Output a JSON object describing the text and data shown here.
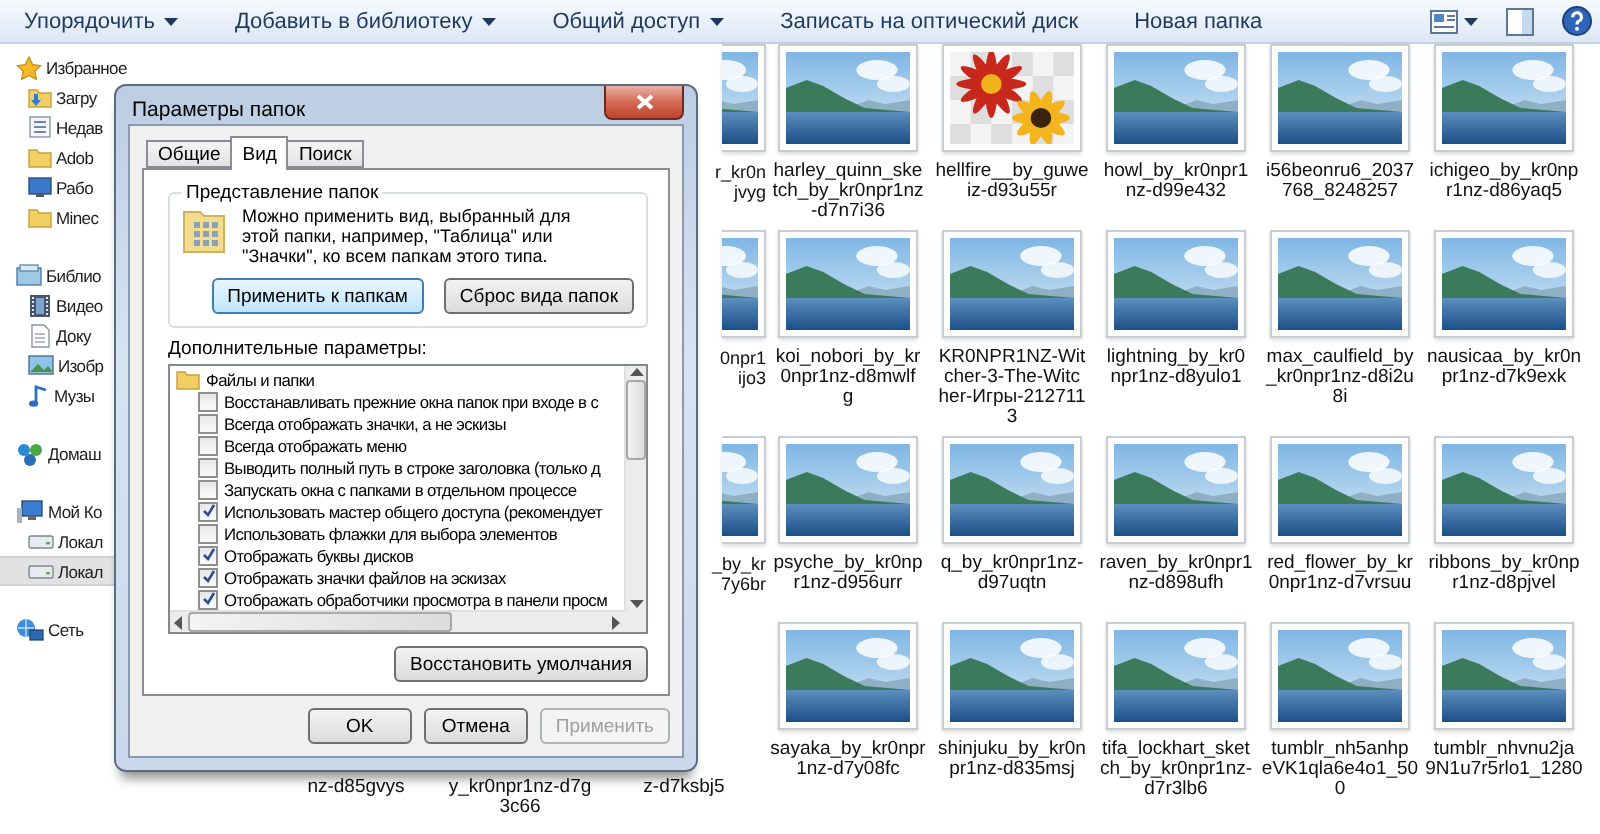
{
  "toolbar": {
    "items": [
      {
        "label": "Упорядочить",
        "dropdown": true
      },
      {
        "label": "Добавить в библиотеку",
        "dropdown": true
      },
      {
        "label": "Общий доступ",
        "dropdown": true
      },
      {
        "label": "Записать на оптический диск",
        "dropdown": false
      },
      {
        "label": "Новая папка",
        "dropdown": false
      }
    ]
  },
  "nav": {
    "groups": [
      {
        "kind": "favorites",
        "label": "Избранное",
        "selected": false,
        "children": [
          {
            "kind": "downloads",
            "label": "Загру",
            "selected": false
          },
          {
            "kind": "recent",
            "label": "Недав",
            "selected": false
          },
          {
            "kind": "folder",
            "label": "Adob",
            "selected": false
          },
          {
            "kind": "desktop",
            "label": "Рабо",
            "selected": false
          },
          {
            "kind": "folder",
            "label": "Minec",
            "selected": false
          }
        ]
      },
      {
        "kind": "library",
        "label": "Библио",
        "selected": false,
        "children": [
          {
            "kind": "videos",
            "label": "Видео",
            "selected": false
          },
          {
            "kind": "documents",
            "label": "Доку",
            "selected": false
          },
          {
            "kind": "pictures",
            "label": "Изобр",
            "selected": false
          },
          {
            "kind": "music",
            "label": "Музы",
            "selected": false
          }
        ]
      },
      {
        "kind": "homegroup",
        "label": "Домаш",
        "selected": false
      },
      {
        "kind": "computer",
        "label": "Мой Ко",
        "selected": false,
        "children": [
          {
            "kind": "drive",
            "label": "Локал",
            "selected": false
          },
          {
            "kind": "drive",
            "label": "Локал",
            "selected": true
          }
        ]
      },
      {
        "kind": "network",
        "label": "Сеть",
        "selected": false
      }
    ]
  },
  "files": {
    "rows": [
      [
        "",
        "",
        {
          "kind": "partial",
          "thumbnail": {
            "kind": "landscape"
          },
          "label_lines": [
            "r_kr0n",
            "jvyg"
          ]
        },
        {
          "kind": "file",
          "thumbnail": {
            "kind": "landscape"
          },
          "label_lines": [
            "harley_quinn_ske",
            "tch_by_kr0npr1nz",
            "-d7n7i36"
          ]
        },
        {
          "kind": "file",
          "thumbnail": {
            "kind": "flowers"
          },
          "label_lines": [
            "hellfire__by_guwe",
            "iz-d93u55r"
          ]
        },
        {
          "kind": "file",
          "thumbnail": {
            "kind": "landscape"
          },
          "label_lines": [
            "howl_by_kr0npr1",
            "nz-d99e432"
          ]
        },
        {
          "kind": "file",
          "thumbnail": {
            "kind": "landscape"
          },
          "label_lines": [
            "i56beonru6_2037",
            "768_8248257"
          ]
        },
        {
          "kind": "file",
          "thumbnail": {
            "kind": "landscape"
          },
          "label_lines": [
            "ichigeo_by_kr0np",
            "r1nz-d86yaq5"
          ]
        }
      ],
      [
        "",
        "",
        {
          "kind": "partial",
          "thumbnail": {
            "kind": "landscape"
          },
          "label_lines": [
            "0npr1",
            "ijo3"
          ]
        },
        {
          "kind": "file",
          "thumbnail": {
            "kind": "landscape"
          },
          "label_lines": [
            "koi_nobori_by_kr",
            "0npr1nz-d8mwlf",
            "g"
          ]
        },
        {
          "kind": "file",
          "thumbnail": {
            "kind": "landscape"
          },
          "label_lines": [
            "KR0NPR1NZ-Wit",
            "cher-3-The-Witc",
            "her-Игры-212711",
            "3"
          ]
        },
        {
          "kind": "file",
          "thumbnail": {
            "kind": "landscape"
          },
          "label_lines": [
            "lightning_by_kr0",
            "npr1nz-d8yulo1"
          ]
        },
        {
          "kind": "file",
          "thumbnail": {
            "kind": "landscape"
          },
          "label_lines": [
            "max_caulfield_by",
            "_kr0npr1nz-d8i2u",
            "8i"
          ]
        },
        {
          "kind": "file",
          "thumbnail": {
            "kind": "landscape"
          },
          "label_lines": [
            "nausicaa_by_kr0n",
            "pr1nz-d7k9exk"
          ]
        }
      ],
      [
        "",
        "",
        {
          "kind": "partial",
          "thumbnail": {
            "kind": "landscape"
          },
          "label_lines": [
            "_by_kr",
            "7y6br"
          ]
        },
        {
          "kind": "file",
          "thumbnail": {
            "kind": "landscape"
          },
          "label_lines": [
            "psyche_by_kr0np",
            "r1nz-d956urr"
          ]
        },
        {
          "kind": "file",
          "thumbnail": {
            "kind": "landscape"
          },
          "label_lines": [
            "q_by_kr0npr1nz-",
            "d97uqtn"
          ]
        },
        {
          "kind": "file",
          "thumbnail": {
            "kind": "landscape"
          },
          "label_lines": [
            "raven_by_kr0npr1",
            "nz-d898ufh"
          ]
        },
        {
          "kind": "file",
          "thumbnail": {
            "kind": "landscape"
          },
          "label_lines": [
            "red_flower_by_kr",
            "0npr1nz-d7vrsuu"
          ]
        },
        {
          "kind": "file",
          "thumbnail": {
            "kind": "landscape"
          },
          "label_lines": [
            "ribbons_by_kr0np",
            "r1nz-d8pjvel"
          ]
        }
      ],
      [
        {
          "kind": "caption",
          "label_lines": [
            "nz-d85gvys"
          ]
        },
        {
          "kind": "caption",
          "label_lines": [
            "y_kr0npr1nz-d7g",
            "3c66"
          ]
        },
        {
          "kind": "caption",
          "label_lines": [
            "z-d7ksbj5"
          ]
        },
        {
          "kind": "file",
          "thumbnail": {
            "kind": "landscape"
          },
          "label_lines": [
            "sayaka_by_kr0npr",
            "1nz-d7y08fc"
          ]
        },
        {
          "kind": "file",
          "thumbnail": {
            "kind": "landscape"
          },
          "label_lines": [
            "shinjuku_by_kr0n",
            "pr1nz-d835msj"
          ]
        },
        {
          "kind": "file",
          "thumbnail": {
            "kind": "landscape"
          },
          "label_lines": [
            "tifa_lockhart_sket",
            "ch_by_kr0npr1nz-",
            "d7r3lb6"
          ]
        },
        {
          "kind": "file",
          "thumbnail": {
            "kind": "landscape"
          },
          "label_lines": [
            "tumblr_nh5anhp",
            "eVK1qla6e4o1_50",
            "0"
          ]
        },
        {
          "kind": "file",
          "thumbnail": {
            "kind": "landscape"
          },
          "label_lines": [
            "tumblr_nhvnu2ja",
            "9N1u7r5rlo1_1280"
          ]
        }
      ]
    ]
  },
  "dialog": {
    "title": "Параметры папок",
    "tabs": [
      {
        "label": "Общие",
        "selected": false
      },
      {
        "label": "Вид",
        "selected": true
      },
      {
        "label": "Поиск",
        "selected": false
      }
    ],
    "folder_views": {
      "title": "Представление папок",
      "text": "Можно применить вид, выбранный для этой папки, например, \"Таблица\" или \"Значки\", ко всем папкам этого типа.",
      "buttons": [
        {
          "label": "Применить к папкам",
          "default": true
        },
        {
          "label": "Сброс вида папок",
          "default": false
        }
      ]
    },
    "advanced": {
      "label": "Дополнительные параметры:",
      "tree": [
        {
          "label": "Файлы и папки",
          "children": [
            {
              "label": "Восстанавливать прежние окна папок при входе в с",
              "checked": false
            },
            {
              "label": "Всегда отображать значки, а не эскизы",
              "checked": false
            },
            {
              "label": "Всегда отображать меню",
              "checked": false
            },
            {
              "label": "Выводить полный путь в строке заголовка (только д",
              "checked": false
            },
            {
              "label": "Запускать окна с папками в отдельном процессе",
              "checked": false
            },
            {
              "label": "Использовать мастер общего доступа (рекомендует",
              "checked": true
            },
            {
              "label": "Использовать флажки для выбора элементов",
              "checked": false
            },
            {
              "label": "Отображать буквы дисков",
              "checked": true
            },
            {
              "label": "Отображать значки файлов на эскизах",
              "checked": true
            },
            {
              "label": "Отображать обработчики просмотра в панели просм",
              "checked": true
            }
          ]
        }
      ]
    },
    "restore_button": "Восстановить умолчания",
    "buttons": [
      {
        "label": "OK",
        "disabled": false
      },
      {
        "label": "Отмена",
        "disabled": false
      },
      {
        "label": "Применить",
        "disabled": true
      }
    ]
  }
}
